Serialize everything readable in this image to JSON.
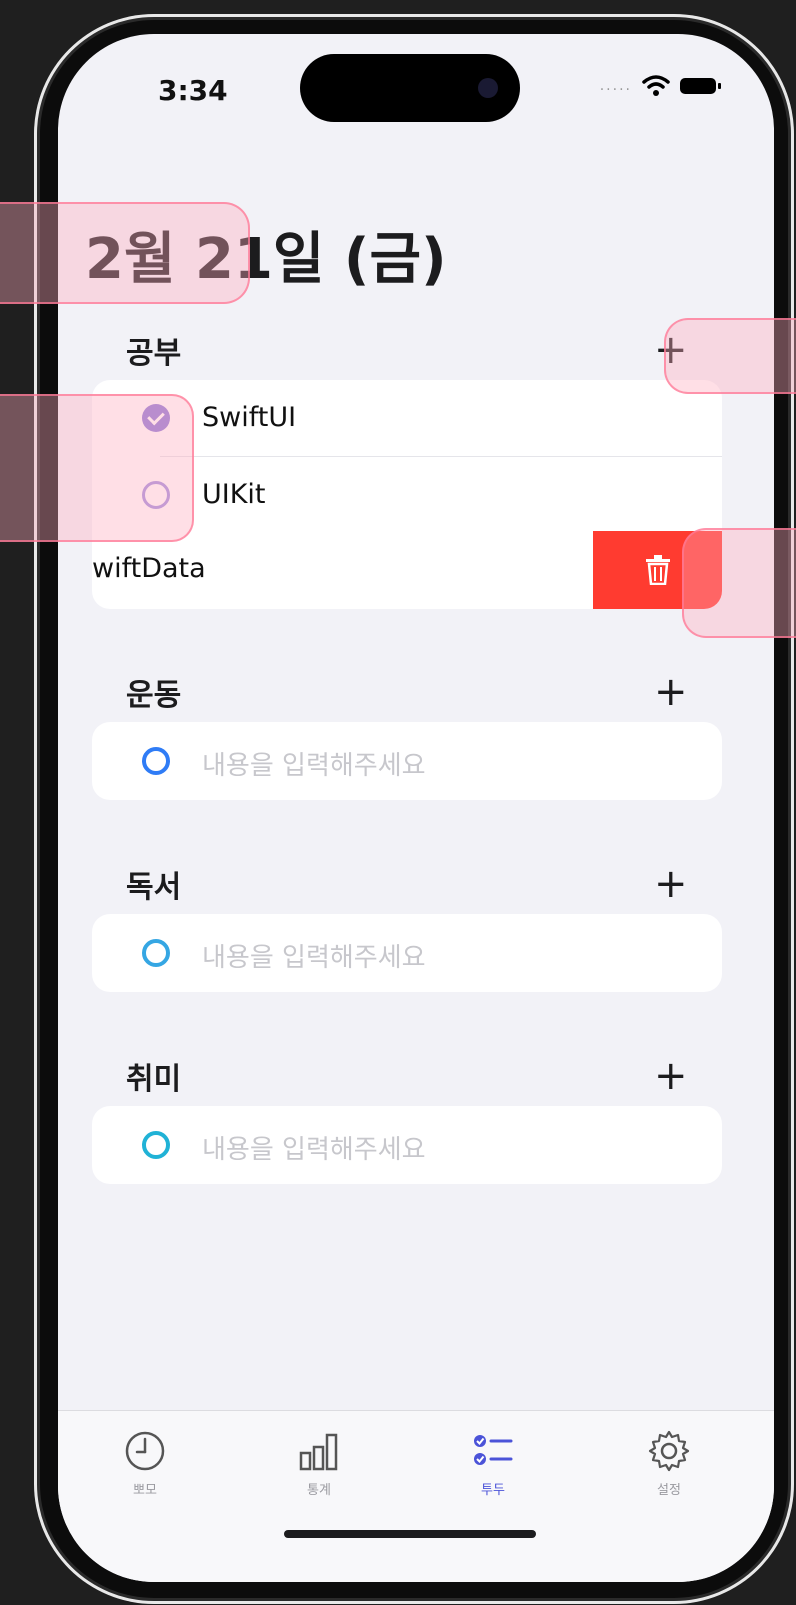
{
  "status_bar": {
    "time": "3:34",
    "signal": "....."
  },
  "header": {
    "title": "2월 21일 (금)"
  },
  "sections": [
    {
      "title": "공부",
      "plus": "+",
      "items": [
        {
          "label": "SwiftUI",
          "done": true
        },
        {
          "label": "UIKit",
          "done": false
        }
      ],
      "swiped_item": {
        "label": "wiftData"
      }
    },
    {
      "title": "운동",
      "plus": "+",
      "placeholder": "내용을 입력해주세요"
    },
    {
      "title": "독서",
      "plus": "+",
      "placeholder": "내용을 입력해주세요"
    },
    {
      "title": "취미",
      "plus": "+",
      "placeholder": "내용을 입력해주세요"
    }
  ],
  "tabs": [
    {
      "label": "뽀모",
      "icon": "timer-icon",
      "active": false
    },
    {
      "label": "통계",
      "icon": "bar-chart-icon",
      "active": false
    },
    {
      "label": "투두",
      "icon": "checklist-icon",
      "active": true
    },
    {
      "label": "설정",
      "icon": "gear-icon",
      "active": false
    }
  ],
  "colors": {
    "accent": "#4b53d8",
    "delete": "#ff3b30",
    "checked": "#8e7bd8",
    "background": "#f2f2f7"
  }
}
